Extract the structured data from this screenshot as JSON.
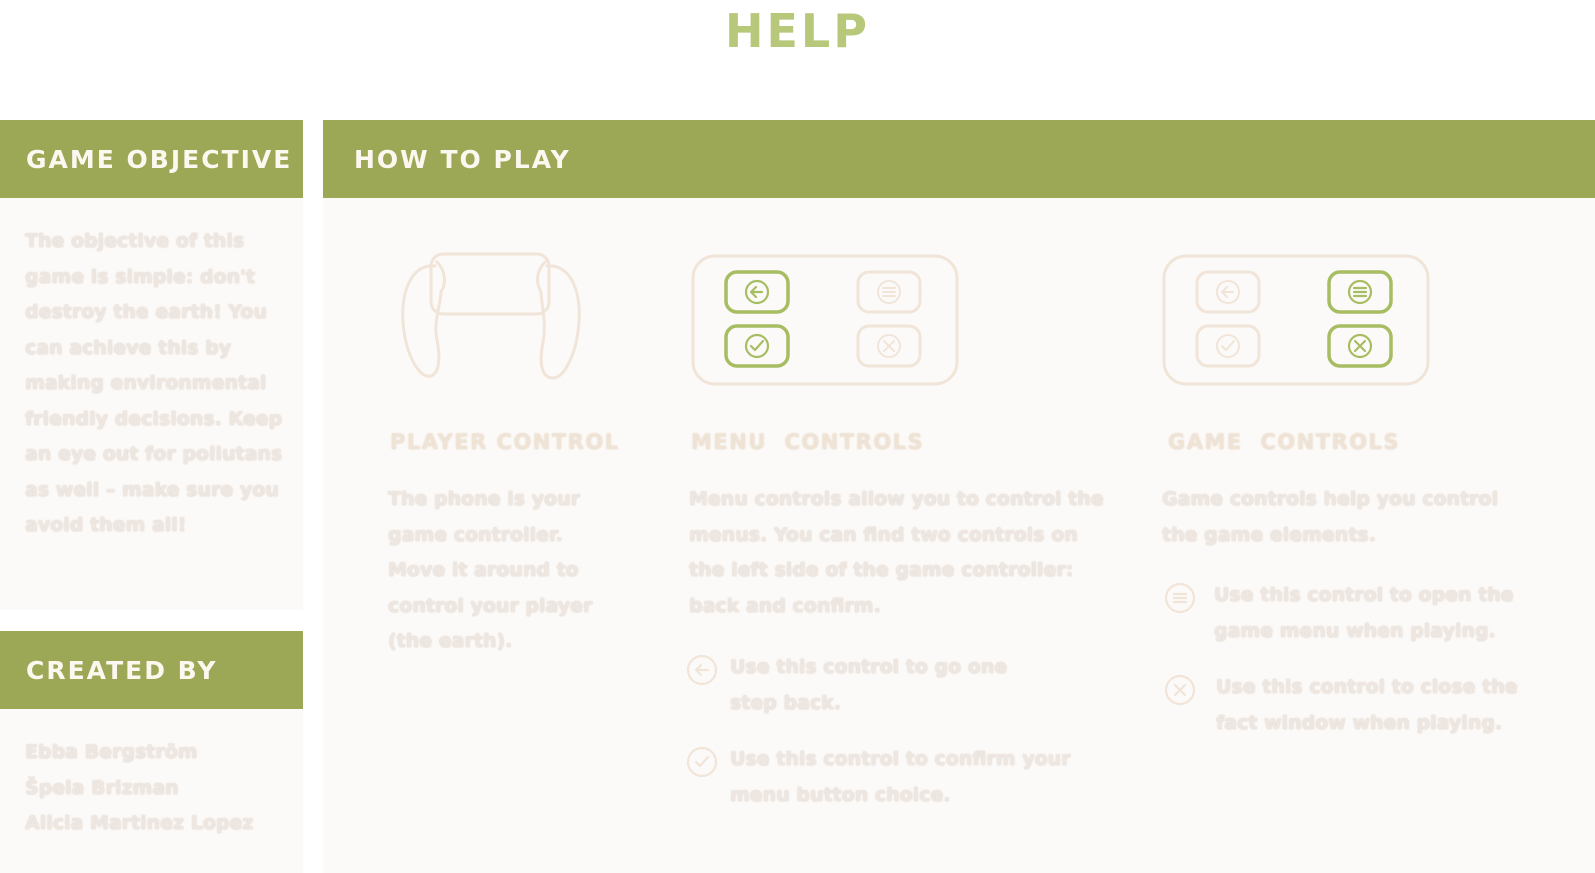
{
  "title": "HELP",
  "sidebar": {
    "objective": {
      "heading": "GAME OBJECTIVE",
      "text": "The objective of this game is simple: don't destroy the earth! You can achieve this by making environmental friendly decisions. Keep an eye out for pollutans as well – make sure you avoid them all!"
    },
    "credits": {
      "heading": "CREATED BY",
      "names": [
        "Ebba Bergström",
        "Špela Brizman",
        "Alicia Martinez Lopez"
      ]
    }
  },
  "how_to_play": {
    "heading": "HOW TO PLAY",
    "player_control": {
      "icon": "phone-hands-icon",
      "heading": "PLAYER CONTROL",
      "text": "The phone is your game controller. Move it around to control your player (the earth)."
    },
    "menu_controls": {
      "icon": "menu-controller-icon",
      "heading": "MENU  CONTROLS",
      "text": "Menu controls allow you to control the menus. You can find two controls on the left side of the game controller: back and confirm.",
      "items": [
        {
          "icon": "back-arrow-icon",
          "text": "Use this control to go one step back."
        },
        {
          "icon": "confirm-check-icon",
          "text": "Use this control to confirm your menu button choice."
        }
      ]
    },
    "game_controls": {
      "icon": "game-controller-icon",
      "heading": "GAME  CONTROLS",
      "text": "Game controls help you control the game elements.",
      "items": [
        {
          "icon": "menu-lines-icon",
          "text": "Use this control to open the game menu when playing."
        },
        {
          "icon": "close-x-icon",
          "text": "Use this control to close the fact window when playing."
        }
      ]
    }
  },
  "colors": {
    "accent": "#9da857",
    "title": "#b7c87a",
    "icon_active": "#a7bd62",
    "icon_faded": "#f1e4d8"
  }
}
